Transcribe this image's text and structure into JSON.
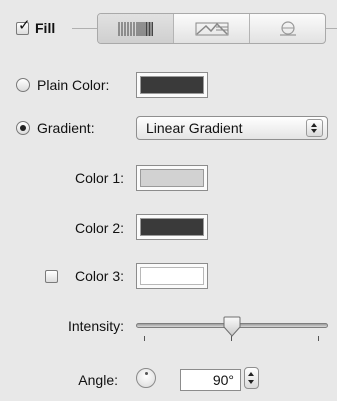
{
  "fill": {
    "label": "Fill",
    "checked": true
  },
  "fill_type_tabs": [
    {
      "icon": "gradient-bars-icon",
      "selected": true
    },
    {
      "icon": "image-fill-icon",
      "selected": false
    },
    {
      "icon": "tinted-image-icon",
      "selected": false
    }
  ],
  "plain_color": {
    "label": "Plain Color:",
    "selected": false,
    "color": "#3a3a3a"
  },
  "gradient": {
    "label": "Gradient:",
    "selected": true,
    "type_value": "Linear Gradient"
  },
  "color1": {
    "label": "Color 1:",
    "color": "#d2d2d2"
  },
  "color2": {
    "label": "Color 2:",
    "color": "#3a3a3a"
  },
  "color3": {
    "label": "Color 3:",
    "checked": false,
    "color": "#ffffff"
  },
  "intensity": {
    "label": "Intensity:",
    "value_fraction": 0.5
  },
  "angle": {
    "label": "Angle:",
    "value": "90°"
  }
}
